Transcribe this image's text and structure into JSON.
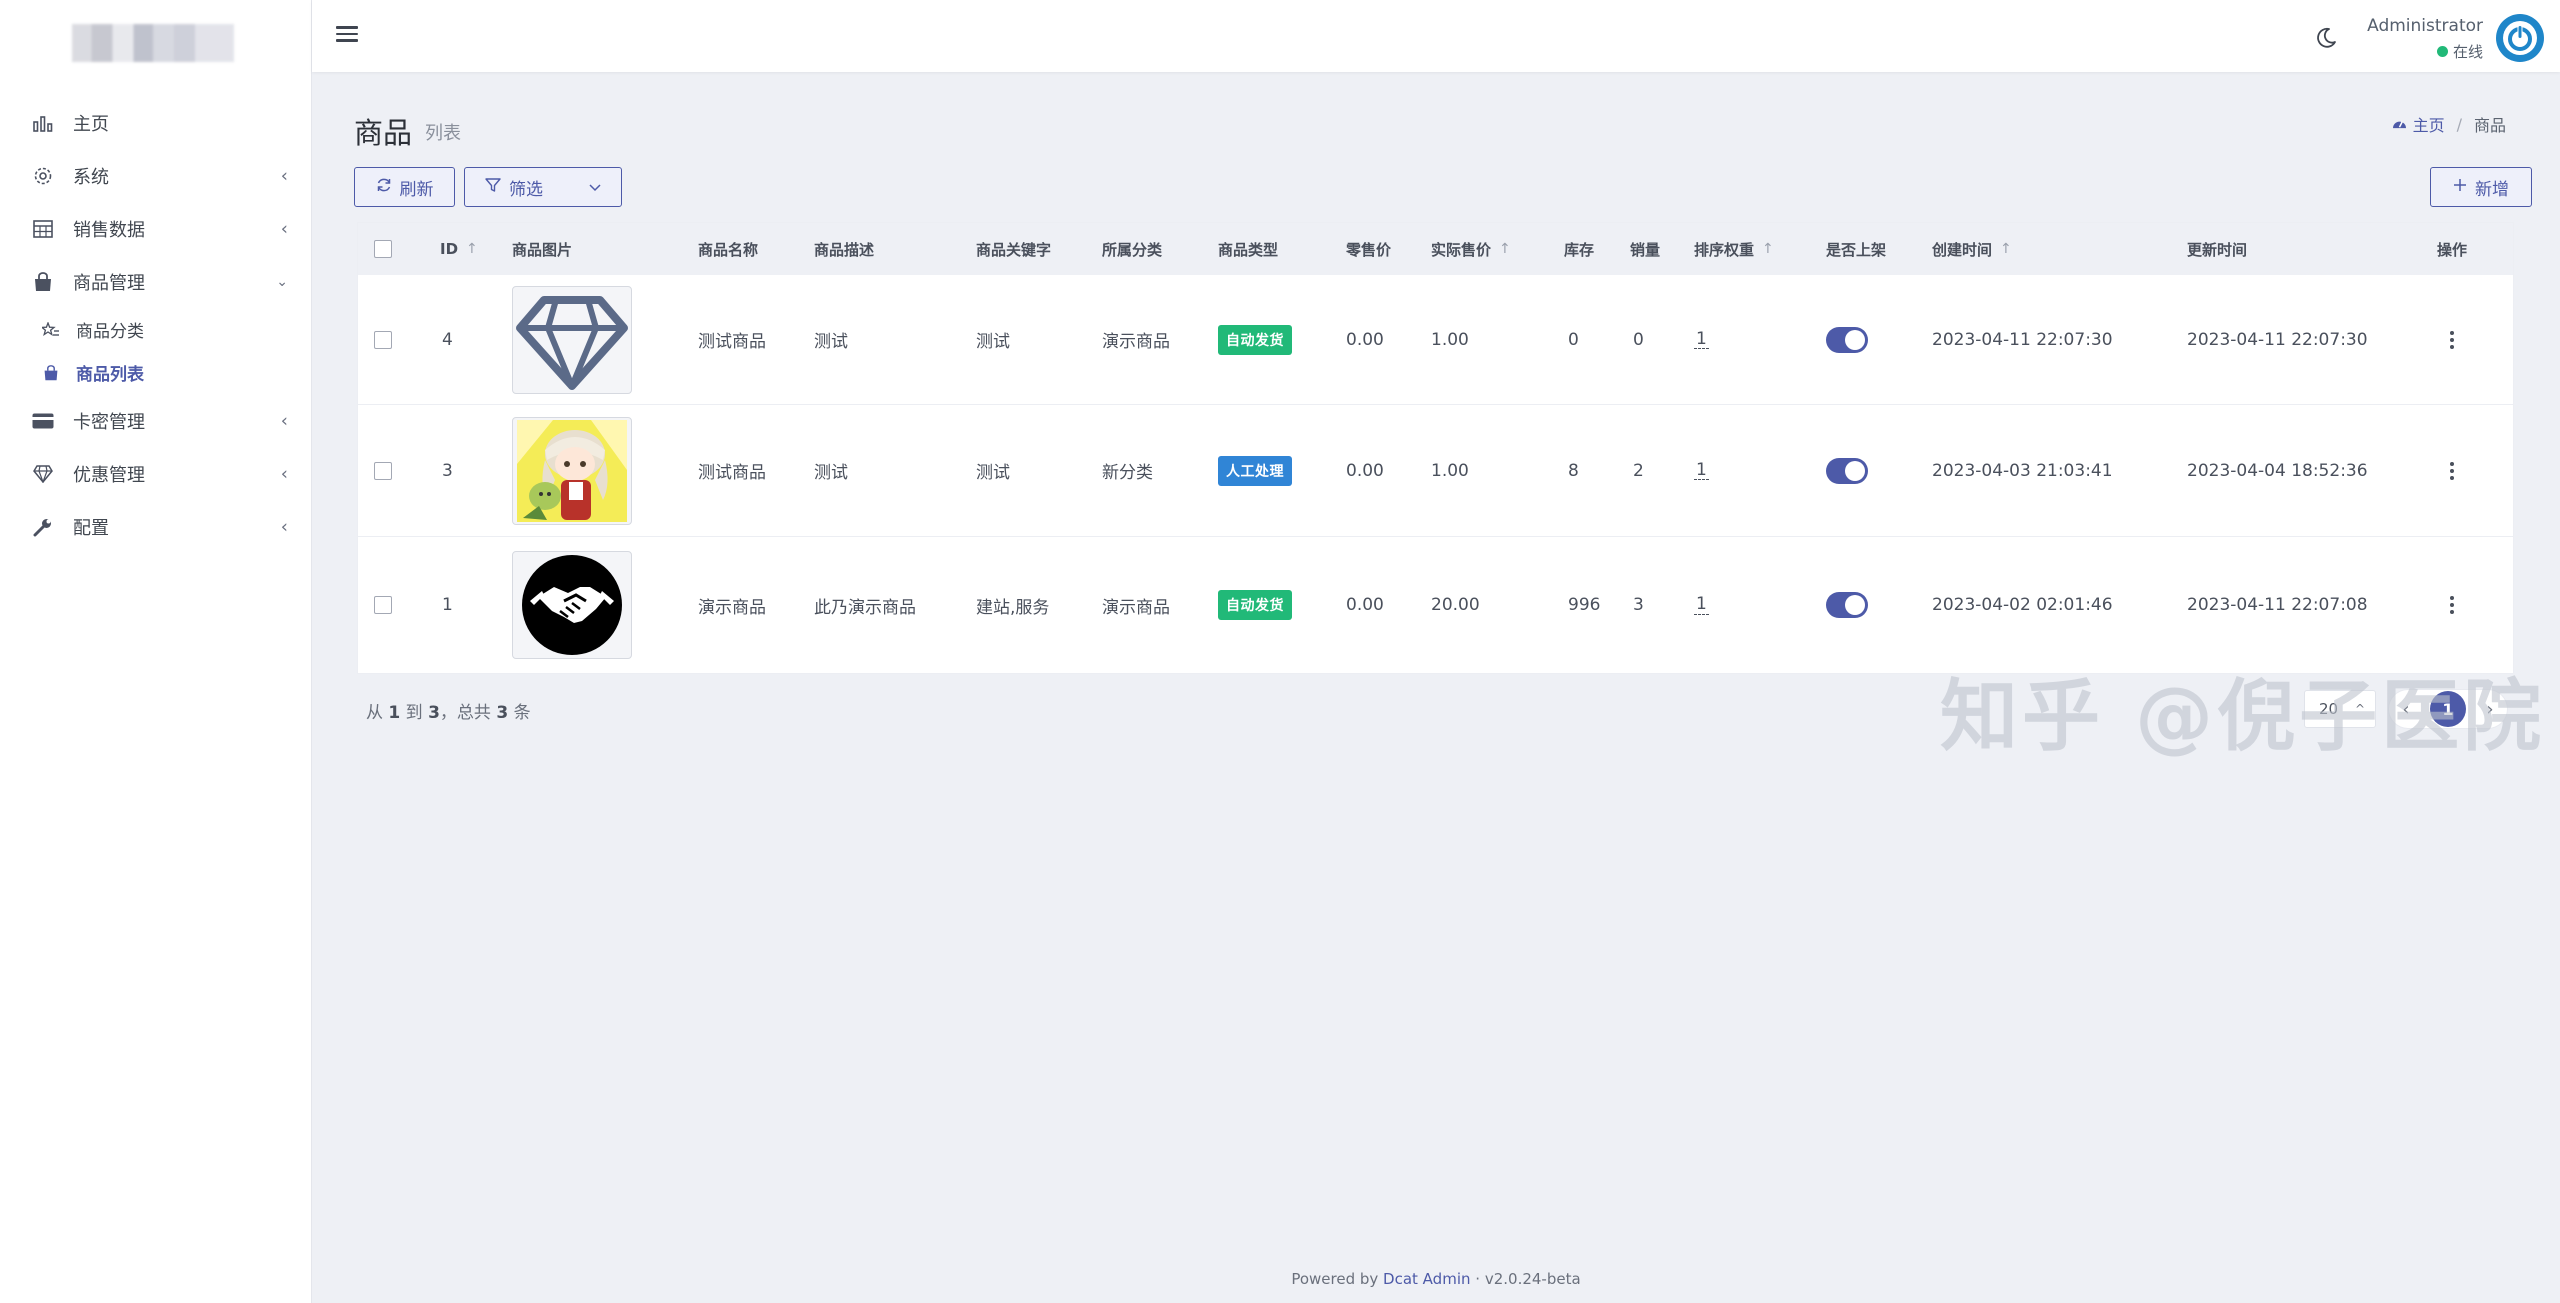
{
  "sidebar": {
    "items": [
      {
        "label": "主页",
        "icon": "bar-chart-icon"
      },
      {
        "label": "系统",
        "icon": "gear-icon"
      },
      {
        "label": "销售数据",
        "icon": "table-icon"
      },
      {
        "label": "商品管理",
        "icon": "shopping-bag-icon"
      },
      {
        "label": "卡密管理",
        "icon": "credit-card-icon"
      },
      {
        "label": "优惠管理",
        "icon": "diamond-icon"
      },
      {
        "label": "配置",
        "icon": "wrench-icon"
      }
    ],
    "sub_items": [
      {
        "label": "商品分类",
        "icon": "star-list-icon"
      },
      {
        "label": "商品列表",
        "icon": "shopping-bag-icon"
      }
    ]
  },
  "topbar": {
    "user_name": "Administrator",
    "user_status": "在线"
  },
  "page": {
    "title": "商品",
    "subtitle": "列表",
    "breadcrumb_home": "主页",
    "breadcrumb_sep": "/",
    "breadcrumb_current": "商品"
  },
  "toolbar": {
    "refresh_label": "刷新",
    "filter_label": "筛选",
    "new_label": "新增"
  },
  "table": {
    "columns": [
      "ID",
      "商品图片",
      "商品名称",
      "商品描述",
      "商品关键字",
      "所属分类",
      "商品类型",
      "零售价",
      "实际售价",
      "库存",
      "销量",
      "排序权重",
      "是否上架",
      "创建时间",
      "更新时间",
      "操作"
    ],
    "rows": [
      {
        "id": "4",
        "image": "diamond-image",
        "name": "测试商品",
        "desc": "测试",
        "keywords": "测试",
        "category": "演示商品",
        "type": "自动发货",
        "type_color": "#21b978",
        "retail": "0.00",
        "price": "1.00",
        "stock": "0",
        "sales": "0",
        "weight": "1",
        "on_sale": true,
        "created": "2023-04-11 22:07:30",
        "updated": "2023-04-11 22:07:30"
      },
      {
        "id": "3",
        "image": "anime-image",
        "name": "测试商品",
        "desc": "测试",
        "keywords": "测试",
        "category": "新分类",
        "type": "人工处理",
        "type_color": "#3085d6",
        "retail": "0.00",
        "price": "1.00",
        "stock": "8",
        "sales": "2",
        "weight": "1",
        "on_sale": true,
        "created": "2023-04-03 21:03:41",
        "updated": "2023-04-04 18:52:36"
      },
      {
        "id": "1",
        "image": "handshake-image",
        "name": "演示商品",
        "desc": "此乃演示商品",
        "keywords": "建站,服务",
        "category": "演示商品",
        "type": "自动发货",
        "type_color": "#21b978",
        "retail": "0.00",
        "price": "20.00",
        "stock": "996",
        "sales": "3",
        "weight": "1",
        "on_sale": true,
        "created": "2023-04-02 02:01:46",
        "updated": "2023-04-11 22:07:08"
      }
    ]
  },
  "pagination": {
    "summary_from_label": "从",
    "from": "1",
    "to_label": "到",
    "to": "3",
    "total_label": "，总共",
    "total": "3",
    "unit": "条",
    "per_page": "20",
    "current_page": "1"
  },
  "watermark": "知乎 @倪子医院",
  "footer": {
    "powered_by": "Powered by",
    "brand": "Dcat Admin",
    "dot": "·",
    "version": "v2.0.24-beta"
  },
  "colors": {
    "primary": "#4d5aa8",
    "success": "#21b978",
    "info": "#3085d6",
    "avatar": "#1f86c9"
  }
}
